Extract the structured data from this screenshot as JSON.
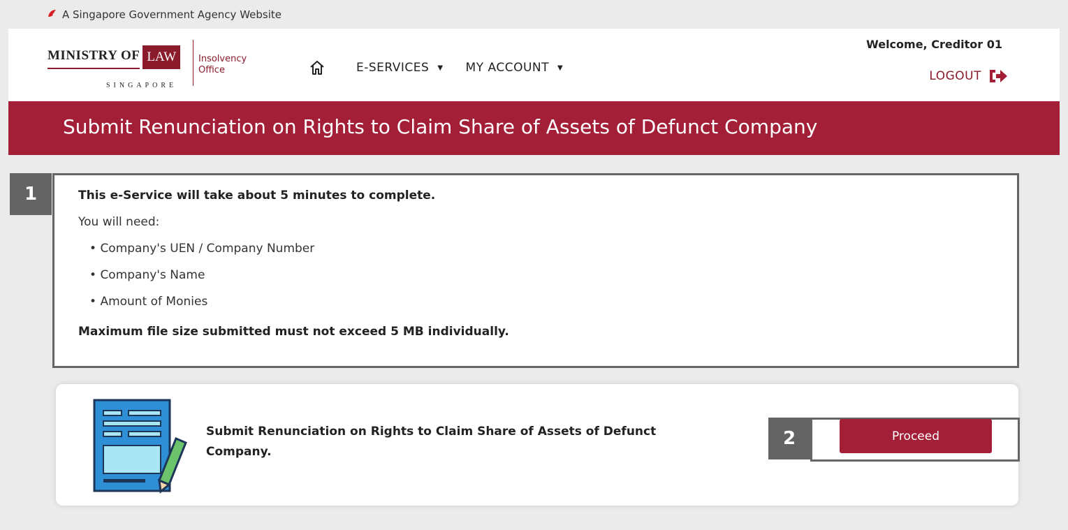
{
  "gov_bar": {
    "text": "A Singapore Government Agency Website"
  },
  "logo": {
    "ministry_a": "MINISTRY OF",
    "ministry_b": "LAW",
    "country": "SINGAPORE",
    "office_line1": "Insolvency",
    "office_line2": "Office"
  },
  "nav": {
    "eservices": "E-SERVICES",
    "my_account": "MY ACCOUNT"
  },
  "user": {
    "welcome": "Welcome, Creditor 01",
    "logout": "LOGOUT"
  },
  "page": {
    "title": "Submit Renunciation on Rights to Claim Share of Assets of Defunct Company"
  },
  "info": {
    "duration": "This e-Service will take about 5 minutes to complete.",
    "need_label": "You will need:",
    "items": [
      "Company's UEN / Company Number",
      "Company's Name",
      "Amount of Monies"
    ],
    "file_note": "Maximum file size submitted must not exceed 5 MB individually."
  },
  "service": {
    "title": "Submit Renunciation on Rights to Claim Share of Assets of Defunct Company.",
    "button": "Proceed"
  },
  "annotations": {
    "badge1": "1",
    "badge2": "2"
  },
  "colors": {
    "brand": "#a31f37",
    "badge": "#646464"
  },
  "icons": [
    "lion-head-icon",
    "home-icon",
    "caret-down-icon",
    "logout-icon",
    "document-pen-icon"
  ]
}
